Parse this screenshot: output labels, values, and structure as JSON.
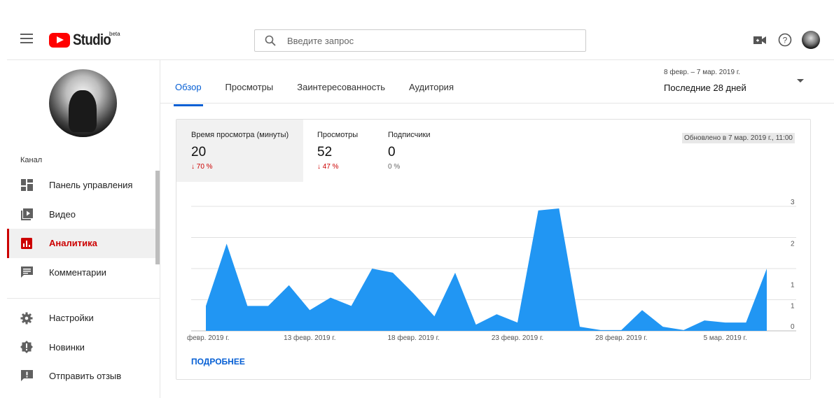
{
  "header": {
    "logo_text": "Studio",
    "beta": "beta",
    "search_placeholder": "Введите запрос"
  },
  "sidebar": {
    "channel_label": "Канал",
    "items": [
      {
        "label": "Панель управления",
        "icon": "dashboard-icon"
      },
      {
        "label": "Видео",
        "icon": "video-icon"
      },
      {
        "label": "Аналитика",
        "icon": "analytics-icon",
        "active": true
      },
      {
        "label": "Комментарии",
        "icon": "comments-icon"
      }
    ],
    "bottom_items": [
      {
        "label": "Настройки",
        "icon": "gear-icon"
      },
      {
        "label": "Новинки",
        "icon": "whats-new-icon"
      },
      {
        "label": "Отправить отзыв",
        "icon": "feedback-icon"
      }
    ]
  },
  "tabs": [
    "Обзор",
    "Просмотры",
    "Заинтересованность",
    "Аудитория"
  ],
  "date_range": {
    "dates": "8 февр. – 7 мар. 2019 г.",
    "label": "Последние 28 дней"
  },
  "metrics": [
    {
      "title": "Время просмотра (минуты)",
      "value": "20",
      "delta": "↓ 70 %",
      "trend": "down"
    },
    {
      "title": "Просмотры",
      "value": "52",
      "delta": "↓ 47 %",
      "trend": "down"
    },
    {
      "title": "Подписчики",
      "value": "0",
      "delta": "0 %",
      "trend": "neutral"
    }
  ],
  "updated": "Обновлено в 7 мар. 2019 г., 11:00",
  "more_link": "ПОДРОБНЕЕ",
  "colors": {
    "accent": "#065fd4",
    "chart_fill": "#2196f3",
    "red": "#cc0000"
  },
  "chart_data": {
    "type": "area",
    "x": [
      "8 февр.",
      "9 февр.",
      "10 февр.",
      "11 февр.",
      "12 февр.",
      "13 февр.",
      "14 февр.",
      "15 февр.",
      "16 февр.",
      "17 февр.",
      "18 февр.",
      "19 февр.",
      "20 февр.",
      "21 февр.",
      "22 февр.",
      "23 февр.",
      "24 февр.",
      "25 февр.",
      "26 февр.",
      "27 февр.",
      "28 февр.",
      "1 мар.",
      "2 мар.",
      "3 мар.",
      "4 мар.",
      "5 мар.",
      "6 мар.",
      "7 мар."
    ],
    "values": [
      0.6,
      2.1,
      0.6,
      0.6,
      1.1,
      0.5,
      0.8,
      0.6,
      1.5,
      1.4,
      0.9,
      0.35,
      1.4,
      0.15,
      0.4,
      0.2,
      2.9,
      2.95,
      0.1,
      0.02,
      0.02,
      0.5,
      0.1,
      0.02,
      0.25,
      0.2,
      0.2,
      1.5
    ],
    "x_tick_labels": [
      "февр. 2019 г.",
      "13 февр. 2019 г.",
      "18 февр. 2019 г.",
      "23 февр. 2019 г.",
      "28 февр. 2019 г.",
      "5 мар. 2019 г."
    ],
    "x_tick_indices": [
      0,
      5,
      10,
      15,
      20,
      25
    ],
    "y_ticks": [
      "3",
      "2",
      "1",
      "1",
      "0"
    ],
    "y_tick_values": [
      3,
      2,
      1,
      0.5,
      0
    ],
    "ylim": [
      0,
      3
    ],
    "grid": true
  }
}
